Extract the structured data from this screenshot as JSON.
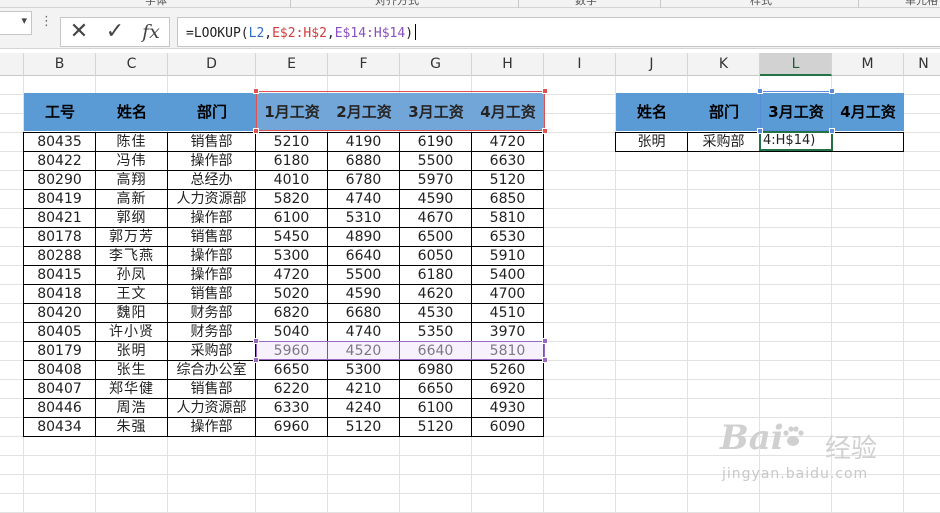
{
  "ribbon": {
    "groups": [
      "字体",
      "对齐方式",
      "数字",
      "样式",
      "单元格"
    ]
  },
  "formula_bar": {
    "kebab": "⋮",
    "cancel_icon": "✕",
    "enter_icon": "✓",
    "fx_label": "fx",
    "formula_parts": [
      {
        "text": "=LOOKUP(",
        "color": "#222222"
      },
      {
        "text": "L2",
        "color": "#2f6dc2"
      },
      {
        "text": ",",
        "color": "#222222"
      },
      {
        "text": "E$2:H$2",
        "color": "#d23c3c"
      },
      {
        "text": ",",
        "color": "#222222"
      },
      {
        "text": "E$14:H$14",
        "color": "#8a4fc0"
      },
      {
        "text": ")",
        "color": "#222222"
      }
    ]
  },
  "column_headers": [
    "B",
    "C",
    "D",
    "E",
    "F",
    "G",
    "H",
    "I",
    "J",
    "K",
    "L",
    "M",
    "N"
  ],
  "selected_column": "L",
  "main_table": {
    "headers": [
      "工号",
      "姓名",
      "部门",
      "1月工资",
      "2月工资",
      "3月工资",
      "4月工资"
    ],
    "rows": [
      [
        "80435",
        "陈佳",
        "销售部",
        "5210",
        "4190",
        "6190",
        "4720"
      ],
      [
        "80422",
        "冯伟",
        "操作部",
        "6180",
        "6880",
        "5500",
        "6630"
      ],
      [
        "80290",
        "高翔",
        "总经办",
        "4010",
        "6780",
        "5970",
        "5120"
      ],
      [
        "80419",
        "高新",
        "人力资源部",
        "5820",
        "4740",
        "4590",
        "6850"
      ],
      [
        "80421",
        "郭纲",
        "操作部",
        "6100",
        "5310",
        "4670",
        "5810"
      ],
      [
        "80178",
        "郭万芳",
        "销售部",
        "5450",
        "4890",
        "6500",
        "6530"
      ],
      [
        "80288",
        "李飞燕",
        "操作部",
        "5300",
        "6640",
        "6050",
        "5910"
      ],
      [
        "80415",
        "孙凤",
        "操作部",
        "4720",
        "5500",
        "6180",
        "5400"
      ],
      [
        "80418",
        "王文",
        "销售部",
        "5020",
        "4590",
        "4620",
        "4700"
      ],
      [
        "80420",
        "魏阳",
        "财务部",
        "6820",
        "6680",
        "4530",
        "4510"
      ],
      [
        "80405",
        "许小贤",
        "财务部",
        "5040",
        "4740",
        "5350",
        "3970"
      ],
      [
        "80179",
        "张明",
        "采购部",
        "5960",
        "4520",
        "6640",
        "5810"
      ],
      [
        "80408",
        "张生",
        "综合办公室",
        "6650",
        "5300",
        "6980",
        "5260"
      ],
      [
        "80407",
        "郑华健",
        "销售部",
        "6220",
        "4210",
        "6650",
        "6920"
      ],
      [
        "80446",
        "周浩",
        "人力资源部",
        "6330",
        "4240",
        "6100",
        "4930"
      ],
      [
        "80434",
        "朱强",
        "操作部",
        "6960",
        "5120",
        "5120",
        "6090"
      ]
    ]
  },
  "lookup_table": {
    "headers": [
      "姓名",
      "部门",
      "3月工资",
      "4月工资"
    ],
    "row": [
      "张明",
      "采购部",
      "",
      ""
    ],
    "active_cell_text": "4:H$14)"
  },
  "watermark": {
    "brand": "Bai",
    "brand_cn": "经验",
    "url": "jingyan.baidu.com"
  }
}
